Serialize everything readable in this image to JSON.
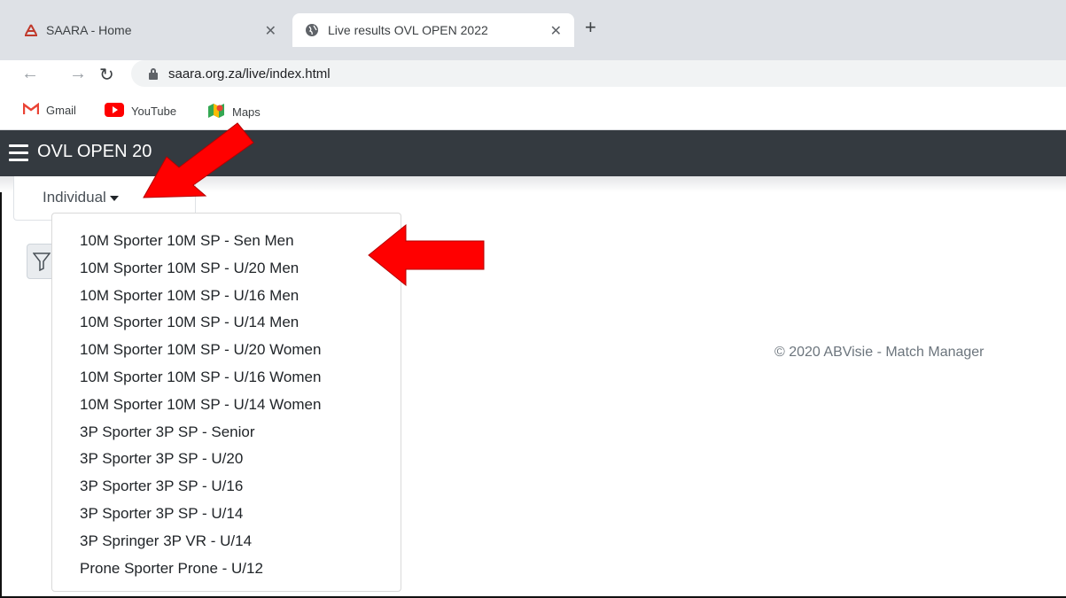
{
  "browser": {
    "tabs": [
      {
        "title": "SAARA - Home",
        "active": false
      },
      {
        "title": "Live results OVL OPEN 2022",
        "active": true
      }
    ],
    "url": "saara.org.za/live/index.html",
    "bookmarks": [
      {
        "label": "Gmail",
        "icon": "gmail-icon"
      },
      {
        "label": "YouTube",
        "icon": "youtube-icon"
      },
      {
        "label": "Maps",
        "icon": "maps-icon"
      }
    ]
  },
  "navbar": {
    "brand": "OVL OPEN 20"
  },
  "tab_button": {
    "label": "Individual"
  },
  "dropdown": {
    "items": [
      "10M Sporter 10M SP - Sen Men",
      "10M Sporter 10M SP - U/20 Men",
      "10M Sporter 10M SP - U/16 Men",
      "10M Sporter 10M SP - U/14 Men",
      "10M Sporter 10M SP - U/20 Women",
      "10M Sporter 10M SP - U/16 Women",
      "10M Sporter 10M SP - U/14 Women",
      "3P Sporter 3P SP - Senior",
      "3P Sporter 3P SP - U/20",
      "3P Sporter 3P SP - U/16",
      "3P Sporter 3P SP - U/14",
      "3P Springer 3P VR - U/14",
      "Prone Sporter Prone - U/12"
    ]
  },
  "footer": {
    "copyright": "© 2020 ABVisie - Match Manager"
  },
  "colors": {
    "navbar": "#343a40",
    "arrow": "#ff0000"
  }
}
